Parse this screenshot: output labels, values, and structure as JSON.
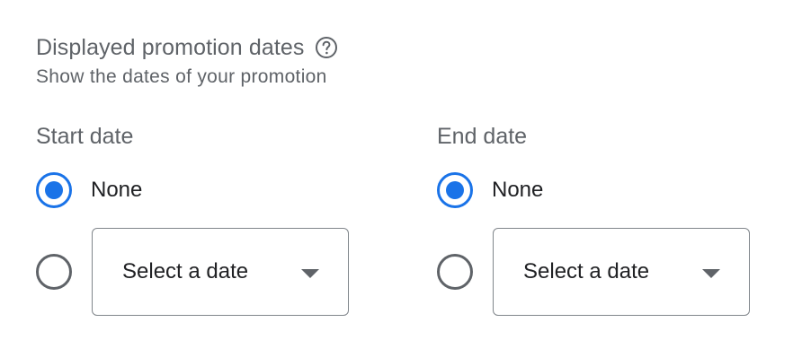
{
  "section": {
    "title": "Displayed promotion dates",
    "subtitle": "Show the dates of your promotion",
    "help_icon": "help-circle-icon"
  },
  "start": {
    "label": "Start date",
    "none_label": "None",
    "none_selected": true,
    "select_placeholder": "Select a date",
    "caret_icon": "dropdown-caret-icon"
  },
  "end": {
    "label": "End date",
    "none_label": "None",
    "none_selected": true,
    "select_placeholder": "Select a date",
    "caret_icon": "dropdown-caret-icon"
  },
  "colors": {
    "accent": "#1a73e8",
    "text_primary": "#202124",
    "text_secondary": "#5f6368",
    "border": "#80868b"
  }
}
